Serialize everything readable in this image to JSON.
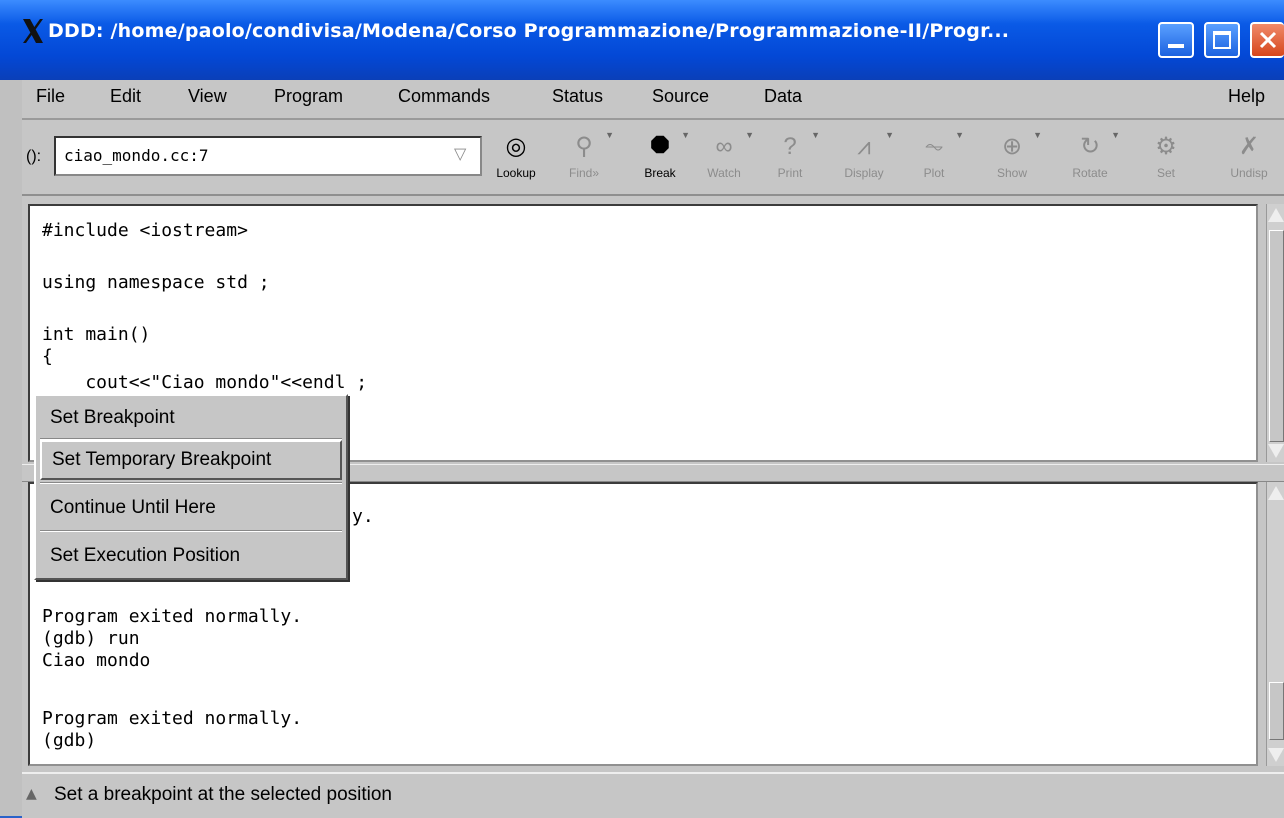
{
  "window": {
    "title": "DDD: /home/paolo/condivisa/Modena/Corso Programmazione/Programmazione-II/Progr...",
    "x_glyph": "X"
  },
  "menubar": {
    "items": [
      "File",
      "Edit",
      "View",
      "Program",
      "Commands",
      "Status",
      "Source",
      "Data",
      "Help"
    ]
  },
  "toolbar": {
    "arg_label": "():",
    "arg_value": "ciao_mondo.cc:7",
    "tools": [
      {
        "label": "Lookup",
        "icon": "lookup-icon",
        "enabled": true
      },
      {
        "label": "Find»",
        "icon": "find-icon",
        "enabled": false
      },
      {
        "label": "Break",
        "icon": "stop-icon",
        "enabled": true
      },
      {
        "label": "Watch",
        "icon": "watch-icon",
        "enabled": false
      },
      {
        "label": "Print",
        "icon": "print-icon",
        "enabled": false
      },
      {
        "label": "Display",
        "icon": "display-icon",
        "enabled": false
      },
      {
        "label": "Plot",
        "icon": "plot-icon",
        "enabled": false
      },
      {
        "label": "Show",
        "icon": "show-icon",
        "enabled": false
      },
      {
        "label": "Rotate",
        "icon": "rotate-icon",
        "enabled": false
      },
      {
        "label": "Set",
        "icon": "set-icon",
        "enabled": false
      },
      {
        "label": "Undisp",
        "icon": "undisplay-icon",
        "enabled": false
      }
    ]
  },
  "source": {
    "lines": [
      "#include <iostream>",
      "",
      "using namespace std ;",
      "",
      "int main()",
      "{",
      "    cout<<\"Ciao mondo\"<<endl ;"
    ]
  },
  "console": {
    "partial_line": "y.",
    "lines": [
      "Program exited normally.",
      "(gdb) run",
      "Ciao mondo",
      "",
      "Program exited normally.",
      "(gdb)"
    ]
  },
  "popup_menu": {
    "items": [
      "Set Breakpoint",
      "Set Temporary Breakpoint",
      "Continue Until Here",
      "Set Execution Position"
    ],
    "highlighted_index": 1
  },
  "status": {
    "text": "Set a breakpoint at the selected position"
  },
  "colors": {
    "titlebar": "#0a5ae6",
    "desktop": "#2a62c9",
    "panel": "#c6c6c6"
  }
}
